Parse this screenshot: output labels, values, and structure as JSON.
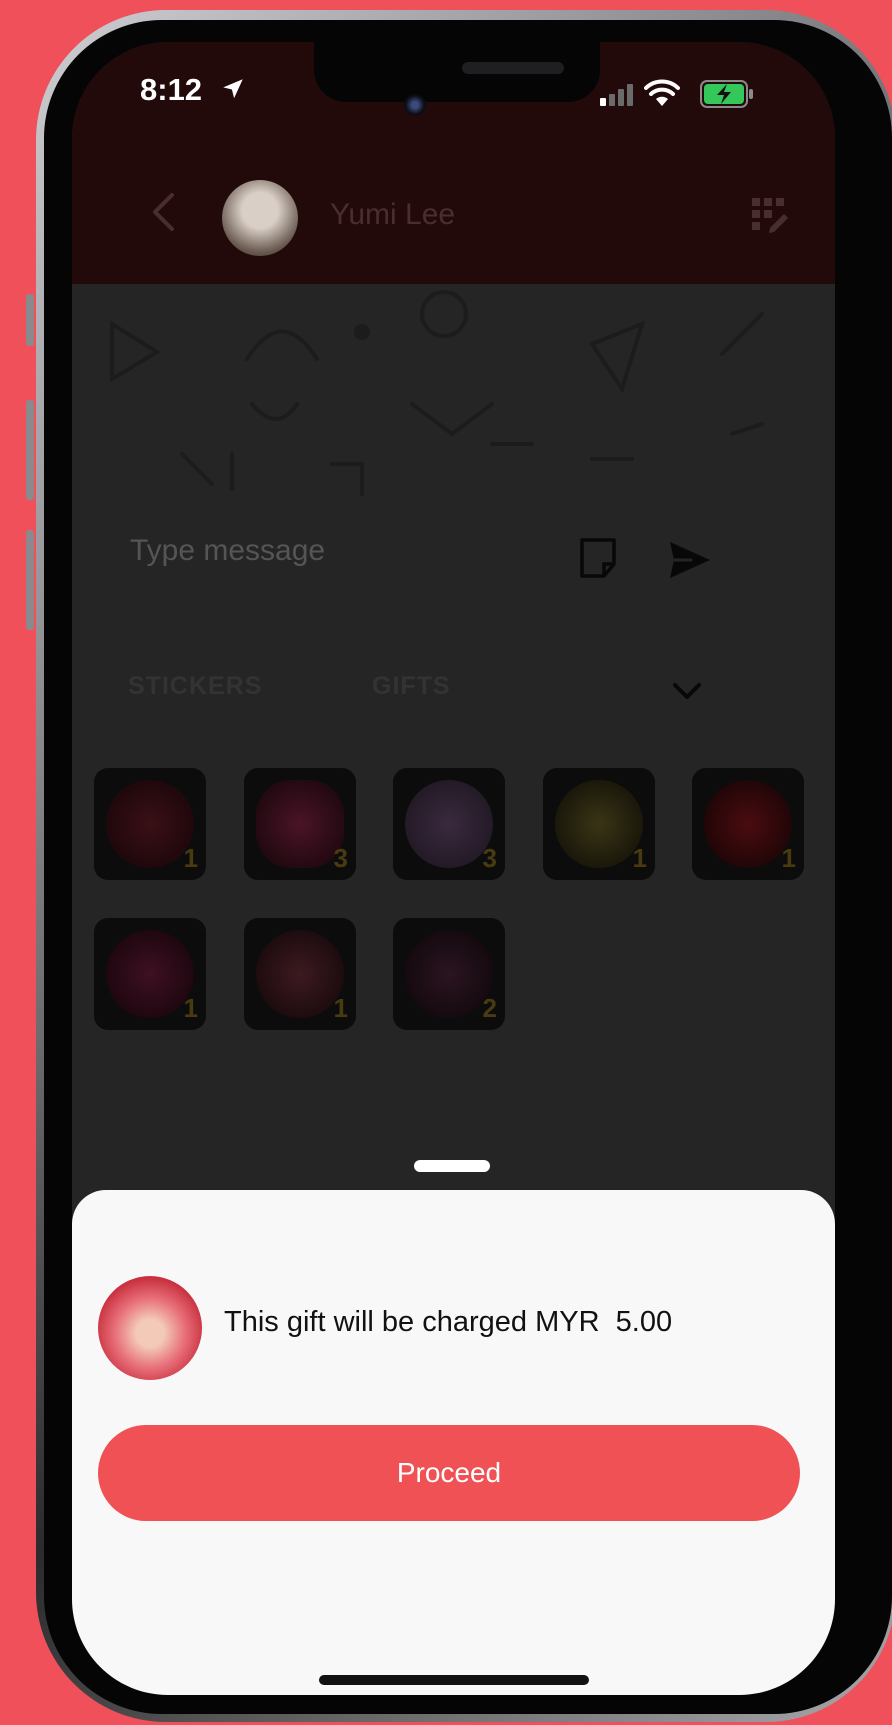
{
  "status_bar": {
    "time": "8:12"
  },
  "header": {
    "contact_name": "Yumi Lee"
  },
  "composer": {
    "placeholder": "Type message"
  },
  "tabs": [
    {
      "label": "STICKERS"
    },
    {
      "label": "GIFTS"
    }
  ],
  "gifts": [
    {
      "count": "1"
    },
    {
      "count": "3"
    },
    {
      "count": "3"
    },
    {
      "count": "1"
    },
    {
      "count": "1"
    },
    {
      "count": "1"
    },
    {
      "count": "1"
    },
    {
      "count": "2"
    }
  ],
  "sheet": {
    "message": "This gift will be charged MYR  5.00",
    "proceed_label": "Proceed"
  },
  "colors": {
    "background": "#f0505a",
    "accent": "#ef5154",
    "header": "#230a0a"
  }
}
